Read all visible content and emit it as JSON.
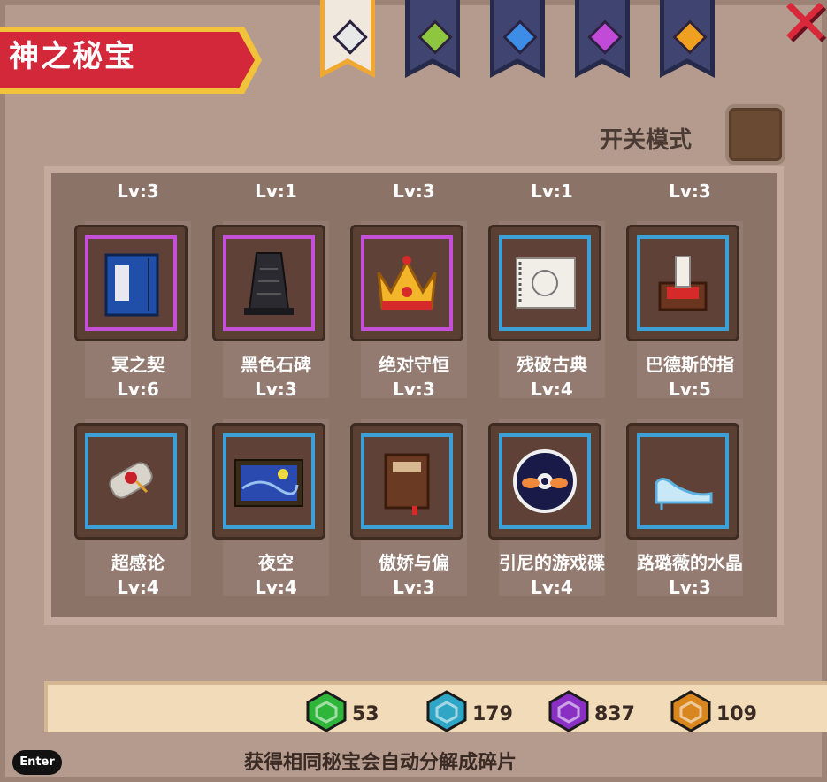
{
  "title": "神之秘宝",
  "tabs": [
    {
      "gem": "white-gem-icon",
      "color": "#e8e8e8"
    },
    {
      "gem": "green-gem-icon",
      "color": "#8fc640"
    },
    {
      "gem": "blue-gem-icon",
      "color": "#3d8de6"
    },
    {
      "gem": "purple-gem-icon",
      "color": "#c24ad9"
    },
    {
      "gem": "orange-gem-icon",
      "color": "#f0a020"
    }
  ],
  "mode_label": "开关模式",
  "top_levels": [
    "Lv:3",
    "Lv:1",
    "Lv:3",
    "Lv:1",
    "Lv:3"
  ],
  "rows": [
    [
      {
        "name": "冥之契",
        "lv": "Lv:6",
        "rarity": "purple",
        "icon": "blue-book-icon"
      },
      {
        "name": "黑色石碑",
        "lv": "Lv:3",
        "rarity": "purple",
        "icon": "black-monolith-icon"
      },
      {
        "name": "绝对守恒",
        "lv": "Lv:3",
        "rarity": "purple",
        "icon": "golden-crown-icon"
      },
      {
        "name": "残破古典",
        "lv": "Lv:4",
        "rarity": "blue",
        "icon": "sketch-paper-icon"
      },
      {
        "name": "巴德斯的指",
        "lv": "Lv:5",
        "rarity": "blue",
        "icon": "candle-altar-icon"
      }
    ],
    [
      {
        "name": "超感论",
        "lv": "Lv:4",
        "rarity": "blue",
        "icon": "scroll-icon"
      },
      {
        "name": "夜空",
        "lv": "Lv:4",
        "rarity": "blue",
        "icon": "starry-night-painting-icon"
      },
      {
        "name": "傲娇与偏",
        "lv": "Lv:3",
        "rarity": "blue",
        "icon": "brown-book-icon"
      },
      {
        "name": "引尼的游戏碟",
        "lv": "Lv:4",
        "rarity": "blue",
        "icon": "game-disc-icon"
      },
      {
        "name": "路璐薇的水晶",
        "lv": "Lv:3",
        "rarity": "blue",
        "icon": "glass-slipper-icon"
      }
    ]
  ],
  "fragments": [
    {
      "icon": "green-fragment-icon",
      "color": "#2fb53a",
      "count": "53"
    },
    {
      "icon": "cyan-fragment-icon",
      "color": "#2fa6c6",
      "count": "179"
    },
    {
      "icon": "purple-fragment-icon",
      "color": "#8a2fc4",
      "count": "837"
    },
    {
      "icon": "orange-fragment-icon",
      "color": "#d9861f",
      "count": "109"
    }
  ],
  "footer_text": "获得相同秘宝会自动分解成碎片",
  "enter_label": "Enter"
}
